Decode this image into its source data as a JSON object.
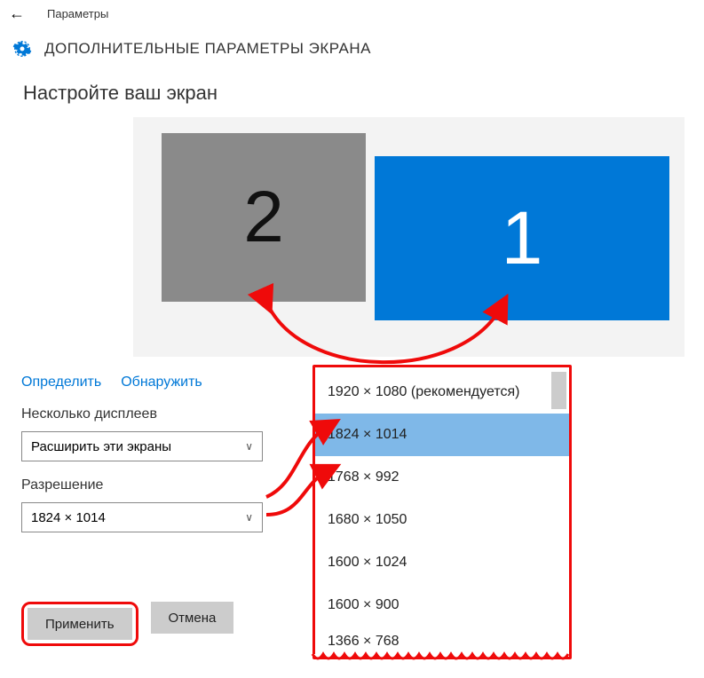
{
  "titlebar": {
    "app_title": "Параметры"
  },
  "header": {
    "title": "ДОПОЛНИТЕЛЬНЫЕ ПАРАМЕТРЫ ЭКРАНА"
  },
  "section": {
    "title": "Настройте ваш экран"
  },
  "monitors": {
    "primary": "1",
    "secondary": "2"
  },
  "links": {
    "identify": "Определить",
    "detect": "Обнаружить"
  },
  "multi_displays": {
    "label": "Несколько дисплеев",
    "value": "Расширить эти экраны"
  },
  "resolution": {
    "label": "Разрешение",
    "value": "1824 × 1014"
  },
  "resolution_options": [
    {
      "label": "1920 × 1080 (рекомендуется)",
      "selected": false
    },
    {
      "label": "1824 × 1014",
      "selected": true
    },
    {
      "label": "1768 × 992",
      "selected": false
    },
    {
      "label": "1680 × 1050",
      "selected": false
    },
    {
      "label": "1600 × 1024",
      "selected": false
    },
    {
      "label": "1600 × 900",
      "selected": false
    },
    {
      "label": "1366 × 768",
      "selected": false
    }
  ],
  "buttons": {
    "apply": "Применить",
    "cancel": "Отмена"
  },
  "colors": {
    "accent": "#0078d7",
    "annotation": "#ef0a0a"
  }
}
